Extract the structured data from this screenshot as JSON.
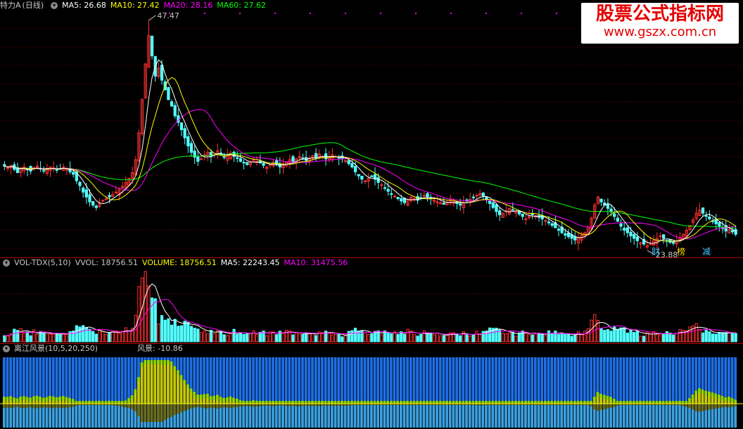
{
  "price_header": {
    "stock": "特力A",
    "period": "(日线)",
    "ma5": "MA5: 26.68",
    "ma10": "MA10: 27.42",
    "ma20": "MA20: 28.16",
    "ma60": "MA60: 27.62"
  },
  "price_annotations": {
    "high": "47.47",
    "low": "23.88"
  },
  "event_badges": [
    "财",
    "榜",
    "减"
  ],
  "volume_header": {
    "name": "VOL-TDX(5,10)",
    "vvol": "VVOL: 18756.51",
    "volume": "VOLUME: 18756.51",
    "ma5": "MA5: 22243.45",
    "ma10": "MA10: 31475.56"
  },
  "indicator_header": {
    "name": "离江风景(10,5,20,250)",
    "value": "风景: -10.86"
  },
  "watermark": {
    "title": "股票公式指标网",
    "url": "www.gszx.com.cn"
  },
  "colors": {
    "up": "#ff3232",
    "down": "#54ffff",
    "ma5": "#ffffff",
    "ma10": "#ffff00",
    "ma20": "#ff00ff",
    "ma60": "#00ff00",
    "grid": "#8b0000",
    "ind_blue": "#1e6fe6",
    "ind_yellow": "#c8c800",
    "ind_green": "#8fd400"
  },
  "chart_data": {
    "type": "candlestick",
    "close_series": [
      29.4,
      29.2,
      29.5,
      29.0,
      28.6,
      29.1,
      29.3,
      29.0,
      28.8,
      29.2,
      29.4,
      29.1,
      28.8,
      29.0,
      29.3,
      29.2,
      28.9,
      29.1,
      29.3,
      29.0,
      28.7,
      28.4,
      27.6,
      27.0,
      26.2,
      25.6,
      25.0,
      24.6,
      24.3,
      24.8,
      25.2,
      25.4,
      25.6,
      25.9,
      26.2,
      26.6,
      26.9,
      27.4,
      27.9,
      28.6,
      30.2,
      33.5,
      37.6,
      42.0,
      45.5,
      43.0,
      40.5,
      41.5,
      40.0,
      38.8,
      37.6,
      36.8,
      35.6,
      34.8,
      33.9,
      32.9,
      31.9,
      31.1,
      30.5,
      30.0,
      30.3,
      30.8,
      31.1,
      30.6,
      30.9,
      31.3,
      30.8,
      30.5,
      30.7,
      31.0,
      30.6,
      30.4,
      30.0,
      29.8,
      29.6,
      29.9,
      30.2,
      30.0,
      29.8,
      29.5,
      29.3,
      29.6,
      29.9,
      29.6,
      29.3,
      29.5,
      29.9,
      30.2,
      30.0,
      30.3,
      30.6,
      30.3,
      30.1,
      30.4,
      30.7,
      30.5,
      30.9,
      30.6,
      30.3,
      30.5,
      30.8,
      30.6,
      30.4,
      30.3,
      30.1,
      29.7,
      29.3,
      28.7,
      28.2,
      27.8,
      27.6,
      27.9,
      28.1,
      27.8,
      27.4,
      27.1,
      26.7,
      26.3,
      26.0,
      25.7,
      25.4,
      25.1,
      24.9,
      25.3,
      25.6,
      25.4,
      25.2,
      25.5,
      25.8,
      25.6,
      25.4,
      25.2,
      25.0,
      24.9,
      24.7,
      24.9,
      25.2,
      25.0,
      24.8,
      24.6,
      24.9,
      25.1,
      25.3,
      25.5,
      25.8,
      26.0,
      25.7,
      25.3,
      24.8,
      24.3,
      23.8,
      23.4,
      23.6,
      23.9,
      24.2,
      24.0,
      23.8,
      23.5,
      23.2,
      22.9,
      23.2,
      23.5,
      23.3,
      23.1,
      22.9,
      22.7,
      22.4,
      22.1,
      21.8,
      21.5,
      21.2,
      20.9,
      20.7,
      20.5,
      20.3,
      20.6,
      20.9,
      21.2,
      21.9,
      23.0,
      24.6,
      25.6,
      25.0,
      24.6,
      24.2,
      23.8,
      23.2,
      22.6,
      22.0,
      21.5,
      21.2,
      20.8,
      20.5,
      20.2,
      20.0,
      19.8,
      19.6,
      19.9,
      20.2,
      20.5,
      20.8,
      20.5,
      20.2,
      20.0,
      19.9,
      20.2,
      20.6,
      21.0,
      21.5,
      22.1,
      22.8,
      23.6,
      24.0,
      23.6,
      23.2,
      22.9,
      22.6,
      22.3,
      22.0,
      21.7,
      21.4,
      21.6,
      21.3,
      21.0
    ],
    "price_range": [
      18.5,
      48.5
    ],
    "high_marker": 47.47,
    "low_marker": 23.88
  }
}
